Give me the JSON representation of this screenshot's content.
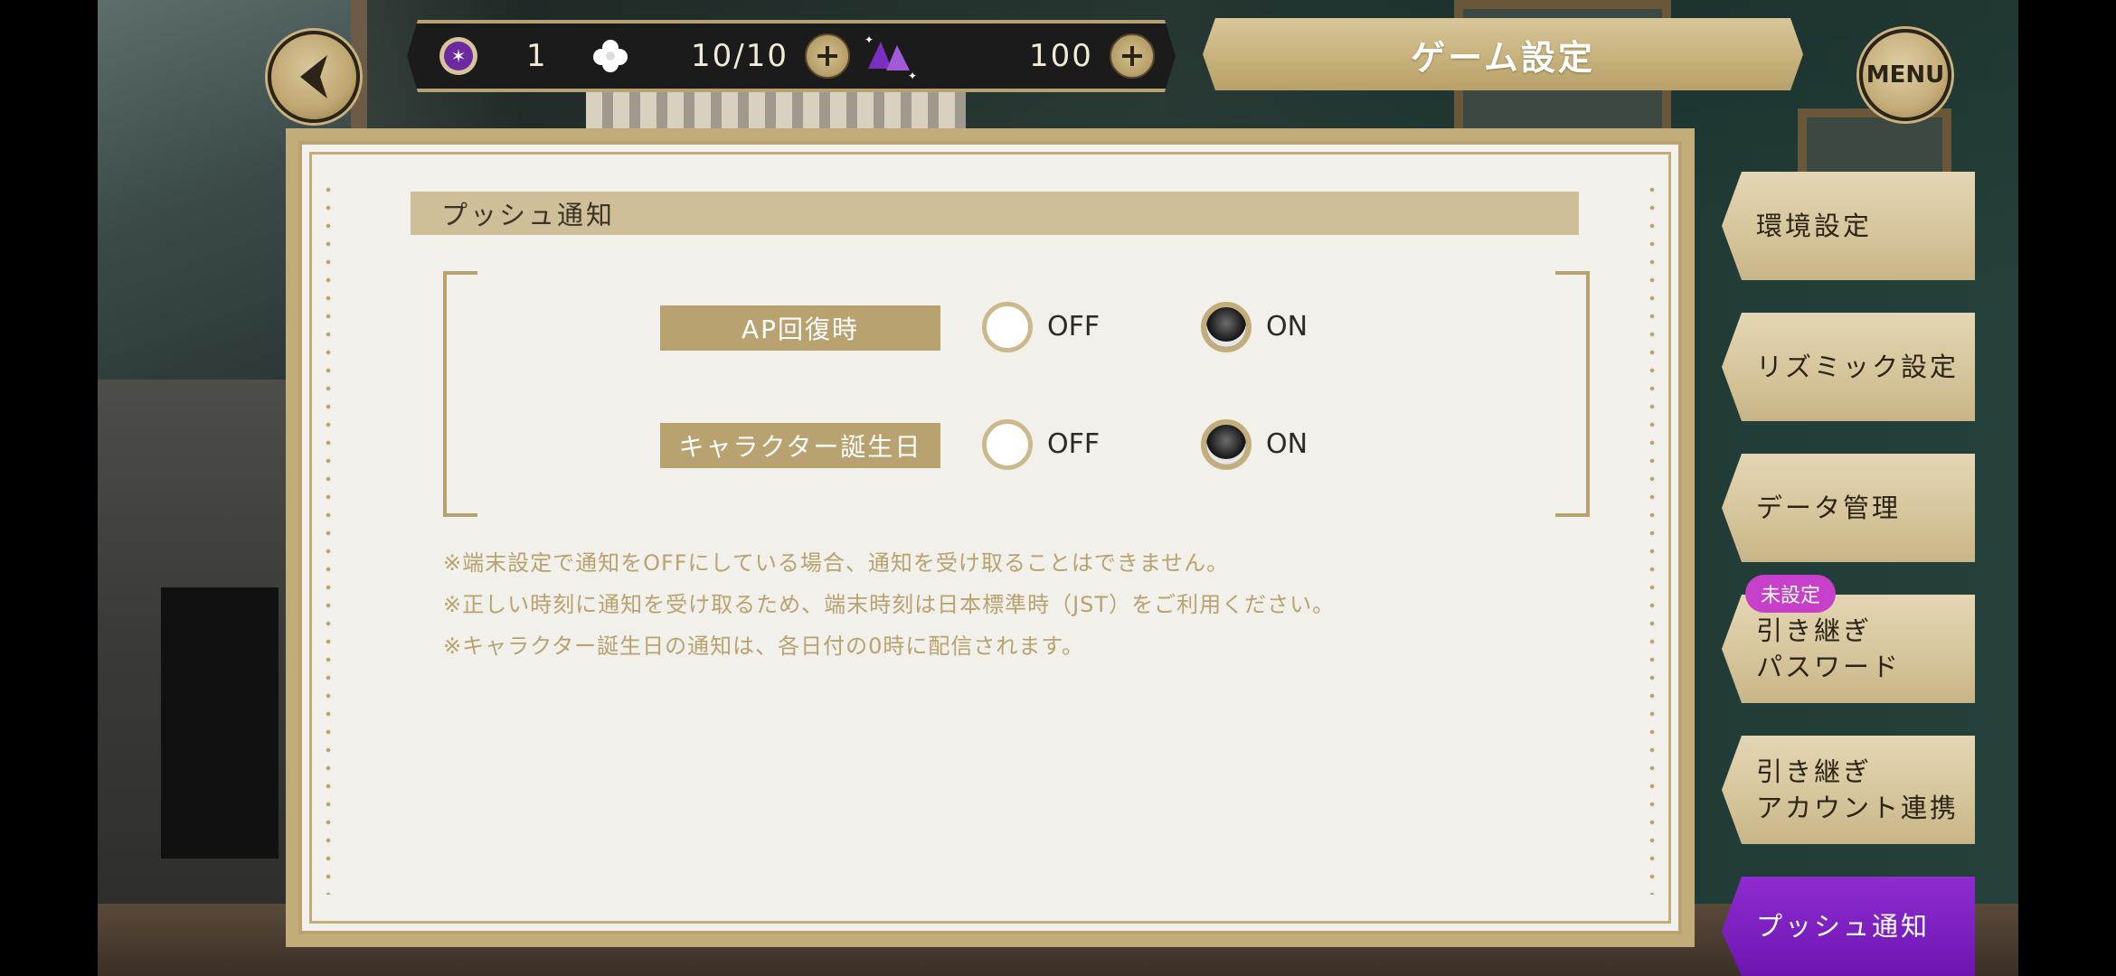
{
  "header": {
    "title": "ゲーム設定",
    "menu_label": "MENU",
    "resources": {
      "gem_count": "1",
      "ap": "10/10",
      "crystal_count": "100"
    }
  },
  "main": {
    "section_title": "プッシュ通知",
    "settings": [
      {
        "label": "AP回復時",
        "off_label": "OFF",
        "on_label": "ON",
        "selected": "ON"
      },
      {
        "label": "キャラクター誕生日",
        "off_label": "OFF",
        "on_label": "ON",
        "selected": "ON"
      }
    ],
    "notes": [
      "※端末設定で通知をOFFにしている場合、通知を受け取ることはできません。",
      "※正しい時刻に通知を受け取るため、端末時刻は日本標準時（JST）をご利用ください。",
      "※キャラクター誕生日の通知は、各日付の0時に配信されます。"
    ]
  },
  "sidebar": {
    "tabs": [
      {
        "line1": "環境設定",
        "line2": ""
      },
      {
        "line1": "リズミック設定",
        "line2": ""
      },
      {
        "line1": "データ管理",
        "line2": ""
      },
      {
        "line1": "引き継ぎ",
        "line2": "パスワード",
        "badge": "未設定"
      },
      {
        "line1": "引き継ぎ",
        "line2": "アカウント連携"
      },
      {
        "line1": "プッシュ通知",
        "line2": "",
        "active": true
      }
    ]
  },
  "colors": {
    "gold": "#b8a26f",
    "active_tab": "#7a1fbe",
    "badge": "#c640c9"
  }
}
